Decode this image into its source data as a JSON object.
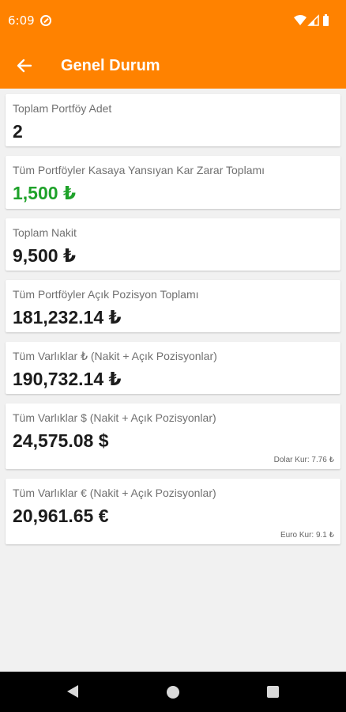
{
  "status_bar": {
    "time": "6:09"
  },
  "header": {
    "title": "Genel Durum"
  },
  "cards": [
    {
      "label": "Toplam Portföy Adet",
      "value": "2"
    },
    {
      "label": "Tüm Portföyler Kasaya Yansıyan Kar Zarar Toplamı",
      "value": "1,500 ₺"
    },
    {
      "label": "Toplam Nakit",
      "value": "9,500 ₺"
    },
    {
      "label": "Tüm Portföyler Açık Pozisyon Toplamı",
      "value": "181,232.14 ₺"
    },
    {
      "label": "Tüm Varlıklar ₺ (Nakit + Açık Pozisyonlar)",
      "value": "190,732.14 ₺"
    },
    {
      "label": "Tüm Varlıklar $ (Nakit + Açık Pozisyonlar)",
      "value": "24,575.08 $",
      "note": "Dolar Kur: 7.76 ₺"
    },
    {
      "label": "Tüm Varlıklar € (Nakit + Açık Pozisyonlar)",
      "value": "20,961.65 €",
      "note": "Euro Kur: 9.1 ₺"
    }
  ],
  "colors": {
    "accent": "#ff8200",
    "positive": "#1fa22a",
    "background": "#f1f1f1",
    "navbar": "#000000"
  },
  "icons": {
    "back": "arrow-left-icon",
    "wifi": "wifi-icon",
    "signal": "signal-icon",
    "battery": "battery-icon"
  }
}
